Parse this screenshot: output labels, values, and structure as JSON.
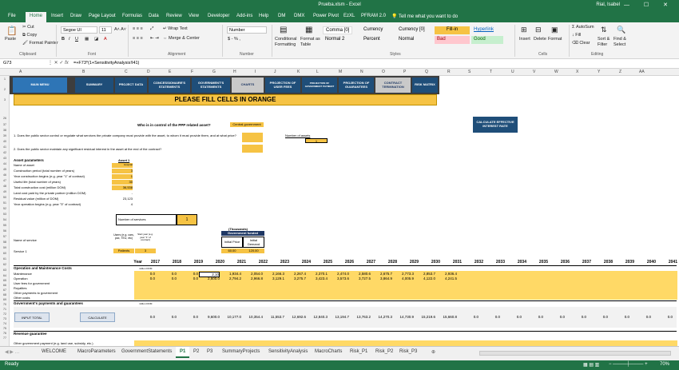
{
  "window": {
    "title": "Prueba.xlsm - Excel",
    "user": "Rial, Isabel",
    "controls": "— ☐ ✕"
  },
  "ribbon_tabs": [
    "File",
    "Home",
    "Insert",
    "Draw",
    "Page Layout",
    "Formulas",
    "Data",
    "Review",
    "View",
    "Developer",
    "Add-ins",
    "Help",
    "DM",
    "DMX",
    "Power Pivot",
    "EzXL",
    "PFRAM 2.0",
    "Tell me what you want to do"
  ],
  "ribbon": {
    "clipboard": {
      "paste": "Paste",
      "cut": "Cut",
      "copy": "Copy",
      "format_painter": "Format Painter",
      "group": "Clipboard"
    },
    "font": {
      "name": "Segoe UI",
      "size": "11",
      "group": "Font"
    },
    "alignment": {
      "wrap": "Wrap Text",
      "merge": "Merge & Center",
      "group": "Alignment"
    },
    "number": {
      "format": "Number",
      "symbols": "$ - % ,",
      "group": "Number"
    },
    "cond": {
      "conditional": "Conditional Formatting",
      "format_as": "Format as Table"
    },
    "styles": {
      "comma0": "Comma [0]",
      "currency": "Currency",
      "currency0": "Currency [0]",
      "fillin": "Fill-in",
      "hyperlink": "Hyperlink",
      "normal2": "Normal 2",
      "percent": "Percent",
      "normal": "Normal",
      "bad": "Bad",
      "good": "Good",
      "group": "Styles"
    },
    "cells": {
      "insert": "Insert",
      "delete": "Delete",
      "format": "Format",
      "group": "Cells"
    },
    "editing": {
      "autosum": "AutoSum",
      "fill": "Fill",
      "clear": "Clear",
      "sort": "Sort & Filter",
      "find": "Find & Select",
      "group": "Editing"
    }
  },
  "formula_bar": {
    "name_box": "G73",
    "formula": "=+F73*(1+SensitivityAnalysis!I41)"
  },
  "columns": [
    "A",
    "B",
    "C",
    "D",
    "E",
    "F",
    "G",
    "H",
    "I",
    "J",
    "K",
    "L",
    "M",
    "N",
    "O",
    "P",
    "Q",
    "R",
    "S",
    "T",
    "U",
    "V",
    "W",
    "X",
    "Y",
    "Z",
    "AA"
  ],
  "row_numbers": [
    "1",
    "2",
    "3",
    "26",
    "37",
    "38",
    "39",
    "40",
    "41",
    "42",
    "43",
    "44",
    "45",
    "46",
    "47",
    "48",
    "49",
    "50",
    "51",
    "52",
    "53",
    "54",
    "55",
    "56",
    "57",
    "58",
    "59",
    "60",
    "61",
    "62",
    "63",
    "64",
    "65",
    "66",
    "67",
    "68",
    "69",
    "70",
    "71",
    "72",
    "73",
    "74",
    "75",
    "76",
    "77",
    "78",
    "79",
    "80",
    "81",
    "82",
    "83",
    "84",
    "85",
    "86",
    "87"
  ],
  "nav_buttons": [
    "MAIN MENU",
    "SUMMARY",
    "PROJECT DATA",
    "CONCESSIONAIRE'S STATEMENTS",
    "GOVERNMENT'S STATEMENTS",
    "CHARTS",
    "PROJECTION OF USER FEES",
    "PROJECTION OF GOVERNMENT PAYMENT",
    "PROJECTION OF GUARANTEES",
    "CONTRACT TERMINATION",
    "RISK MATRIX"
  ],
  "banner": "PLEASE FILL CELLS IN ORANGE",
  "calc_button": "CALCULATE EFFECTIVE INTEREST RATE",
  "control": {
    "question": "Who is in control of the PPP related asset?",
    "answer": "Central government"
  },
  "questions": {
    "q1": "1. Does the public sector control or regulate what services the private company must provide with the asset, to whom it must provide them, and at what price?",
    "q2": "2. Does the public sector maintain any significant residual interest in the asset at the end of the contract?"
  },
  "num_assets": {
    "label": "Number of assets",
    "value": "1"
  },
  "asset_params": {
    "title": "Asset parameters",
    "header": "Asset 1",
    "rows": [
      {
        "label": "Name of asset",
        "value": "Hospital"
      },
      {
        "label": "Construction period (total number of years)",
        "value": "3"
      },
      {
        "label": "Year construction begins (e.g. year \"1\" of contract)",
        "value": "1"
      },
      {
        "label": "Useful life (total number of years)",
        "value": "30"
      },
      {
        "label": "Total construction cost (million DOM)",
        "value": "36,538"
      },
      {
        "label": "Land cost paid by the private partner (million DOM)",
        "value": "-"
      },
      {
        "label": "Residual value (million of DOM)",
        "value": "23,123"
      },
      {
        "label": "Year operation begins (e.g. year \"3\" of contract)",
        "value": "4"
      }
    ]
  },
  "services": {
    "label": "Number of services",
    "value": "1"
  },
  "service_table": {
    "name_col": "Name of service",
    "users_col": "Users (e.g. cars, pax, TEU, etc)",
    "start_col": "Start year (e.g. year \"1\" of contract)",
    "row_label": "Service 1",
    "users": "Patients",
    "start": "3"
  },
  "gov_funded": {
    "units": "(Thousands)",
    "title": "Government funded",
    "price_col": "Initial Price",
    "demand_col": "Initial Demand",
    "price": "60.00",
    "demand": "120.00"
  },
  "years": [
    "Year",
    "2017",
    "2018",
    "2019",
    "2020",
    "2021",
    "2022",
    "2023",
    "2024",
    "2025",
    "2026",
    "2027",
    "2028",
    "2029",
    "2030",
    "2031",
    "2032",
    "2033",
    "2034",
    "2035",
    "2036",
    "2037",
    "2038",
    "2039",
    "2040",
    "2041"
  ],
  "om": {
    "title": "Operation and Maintenance Costs",
    "unit": "million DOM",
    "rows": [
      "Maintenance",
      "Operation",
      "User fees for government",
      "Royalties",
      "Other payments to government",
      "Other costs"
    ],
    "maintenance": [
      "0.0",
      "0.0",
      "0.0",
      "2,10",
      "1,934.4",
      "2,054.0",
      "2,166.3",
      "2,267.4",
      "2,370.1",
      "2,474.0",
      "2,580.6",
      "2,675.7",
      "2,773.3",
      "2,853.7",
      "2,936.4"
    ],
    "operation": [
      "0.0",
      "0.0",
      "0.0",
      "2,600.0",
      "2,794.2",
      "2,966.8",
      "3,129.1",
      "3,275.7",
      "3,423.4",
      "3,573.6",
      "3,727.5",
      "3,864.9",
      "4,005.9",
      "4,122.0",
      "4,241.5"
    ]
  },
  "gov_payments": {
    "title": "Government's payments and guarantees",
    "unit": "million DOM",
    "input_total": "INPUT TOTAL",
    "calculate": "CALCULATE",
    "values": [
      "0.0",
      "0.0",
      "0.0",
      "9,600.0",
      "10,177.0",
      "10,354.4",
      "11,553.7",
      "12,692.6",
      "12,840.3",
      "13,194.7",
      "13,763.2",
      "14,270.3",
      "14,730.9",
      "15,219.6",
      "15,660.8",
      "0.0",
      "0.0",
      "0.0",
      "0.0",
      "0.0",
      "0.0",
      "0.0",
      "0.0",
      "0.0",
      "0.0"
    ]
  },
  "revenue": {
    "title": "Revenue guarantee",
    "row": "Other government payment (e.g. land use, subsidy, etc.)"
  },
  "sheet_tabs": [
    "WELCOME",
    "MacroParameters",
    "GovernmentStatements",
    "P1",
    "P2",
    "P3",
    "SummaryProjects",
    "SensitivityAnalysis",
    "MacroCharts",
    "Risk_P1",
    "Risk_P2",
    "Risk_P3"
  ],
  "active_sheet": "P1",
  "status": {
    "left": "Ready",
    "zoom": "70%"
  },
  "colors": {
    "excel_green": "#217346",
    "nav_blue": "#1f4e79",
    "orange": "#f6c344"
  }
}
